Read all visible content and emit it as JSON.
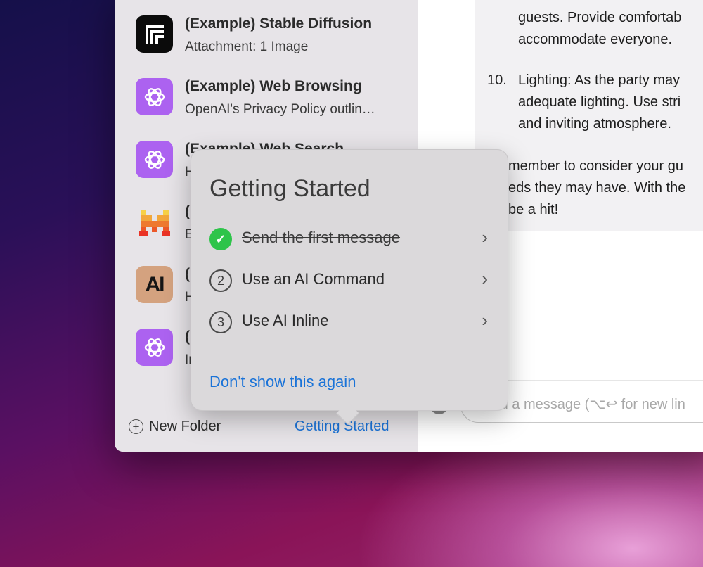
{
  "sidebar": {
    "items": [
      {
        "title": "(Example) Stable Diffusion",
        "subtitle": "Attachment: 1 Image",
        "icon": "stable-diffusion-logo-icon"
      },
      {
        "title": "(Example) Web Browsing",
        "subtitle": "OpenAI's Privacy Policy outlin…",
        "icon": "openai-logo-icon"
      },
      {
        "title": "(Example) Web Search",
        "subtitle": "H",
        "icon": "openai-logo-icon"
      },
      {
        "title": "(",
        "subtitle": "E",
        "icon": "mistral-logo-icon"
      },
      {
        "title": "(",
        "subtitle": "H",
        "icon": "anthropic-logo-icon",
        "icon_text": "AI"
      },
      {
        "title": "(",
        "subtitle": "In",
        "icon": "openai-logo-icon"
      }
    ],
    "footer": {
      "new_folder": "New Folder",
      "getting_started": "Getting Started"
    }
  },
  "message": {
    "lines": [
      "guests. Provide comfortab",
      "accommodate everyone.",
      "10.",
      "Lighting: As the party may",
      "adequate lighting. Use stri",
      "and inviting atmosphere.",
      "member to consider your gu",
      "eds they may have. With the",
      "be a hit!"
    ]
  },
  "composer": {
    "placeholder": "Send a message (⌥↩ for new lin"
  },
  "popover": {
    "title": "Getting Started",
    "steps": [
      {
        "badge": "✓",
        "label": "Send the first message",
        "done": true
      },
      {
        "badge": "2",
        "label": "Use an AI Command",
        "done": false
      },
      {
        "badge": "3",
        "label": "Use AI Inline",
        "done": false
      }
    ],
    "dismiss": "Don't show this again"
  },
  "colors": {
    "accent": "#1a73d8",
    "success": "#2ec44a",
    "openai": "#ac62f0",
    "anthropic": "#d4a27f"
  }
}
